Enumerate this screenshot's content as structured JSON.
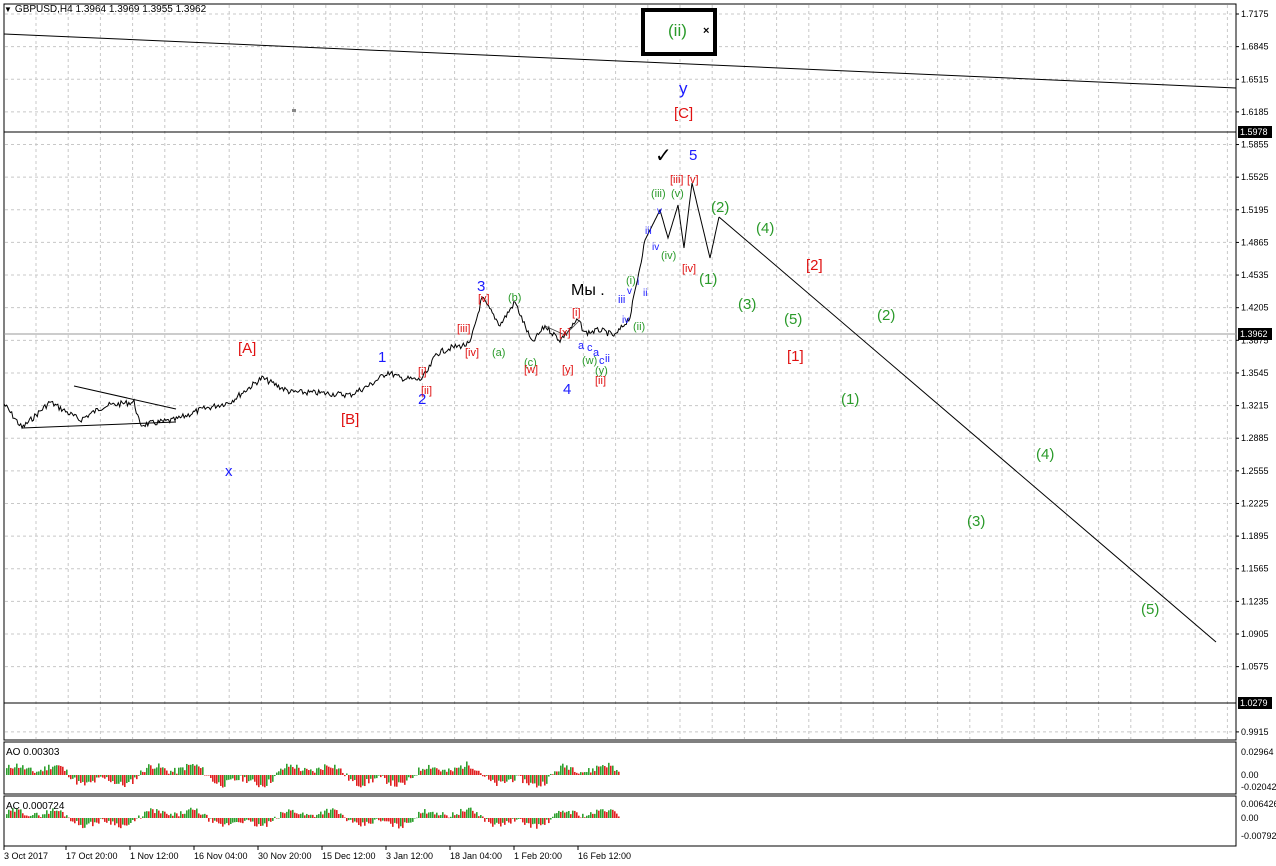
{
  "window": {
    "symbol": "GBPUSD,H4",
    "ohlc": "1.3964 1.3969 1.3955 1.3962"
  },
  "price_axis": {
    "labels": [
      "1.7175",
      "1.6845",
      "1.6515",
      "1.6185",
      "1.5855",
      "1.5525",
      "1.5195",
      "1.4865",
      "1.4535",
      "1.4205",
      "1.3875",
      "1.3545",
      "1.3215",
      "1.2885",
      "1.2555",
      "1.2225",
      "1.1895",
      "1.1565",
      "1.1235",
      "1.0905",
      "1.0575",
      "0.9915"
    ],
    "line_top_label": "1.5978",
    "current_label": "1.3962",
    "line_bottom_label": "1.0279"
  },
  "time_axis": {
    "labels": [
      "3 Oct 2017",
      "17 Oct 20:00",
      "1 Nov 12:00",
      "16 Nov 04:00",
      "30 Nov 20:00",
      "15 Dec 12:00",
      "3 Jan 12:00",
      "18 Jan 04:00",
      "1 Feb 20:00",
      "16 Feb 12:00"
    ]
  },
  "indicators": {
    "ao": {
      "title": "AO 0.00303",
      "axis": [
        "0.02964",
        "0.00",
        "-0.02042"
      ]
    },
    "ac": {
      "title": "AC 0.000724",
      "axis": [
        "0.006426",
        "0.00",
        "-0.00792"
      ]
    }
  },
  "annotations": {
    "box_label": "(ii)",
    "box_close": "×",
    "my_label": "Мы .",
    "check": "✓",
    "w": [
      {
        "t": "y",
        "c": "#1a1aff",
        "s": 17
      },
      {
        "t": "[C]",
        "c": "#e01010",
        "s": 15
      },
      {
        "t": "5",
        "c": "#1a1aff",
        "s": 15
      },
      {
        "t": "[A]",
        "c": "#e01010",
        "s": 15
      },
      {
        "t": "1",
        "c": "#1a1aff",
        "s": 15
      },
      {
        "t": "[B]",
        "c": "#e01010",
        "s": 15
      },
      {
        "t": "x",
        "c": "#1a1aff",
        "s": 15
      },
      {
        "t": "2",
        "c": "#1a1aff",
        "s": 15
      },
      {
        "t": "3",
        "c": "#1a1aff",
        "s": 15
      },
      {
        "t": "4",
        "c": "#1a1aff",
        "s": 15
      },
      {
        "t": "[i]",
        "c": "#e01010",
        "s": 11
      },
      {
        "t": "[ii]",
        "c": "#e01010",
        "s": 11
      },
      {
        "t": "[iii]",
        "c": "#e01010",
        "s": 11
      },
      {
        "t": "[iv]",
        "c": "#e01010",
        "s": 11
      },
      {
        "t": "[v]",
        "c": "#e01010",
        "s": 11
      },
      {
        "t": "(a)",
        "c": "#2a9a2a",
        "s": 11
      },
      {
        "t": "(b)",
        "c": "#2a9a2a",
        "s": 11
      },
      {
        "t": "(c)",
        "c": "#2a9a2a",
        "s": 11
      },
      {
        "t": "[w]",
        "c": "#e01010",
        "s": 11
      },
      {
        "t": "[x]",
        "c": "#e01010",
        "s": 11
      },
      {
        "t": "[y]",
        "c": "#e01010",
        "s": 11
      },
      {
        "t": "[i]",
        "c": "#e01010",
        "s": 11
      },
      {
        "t": "a",
        "c": "#1a1aff",
        "s": 11
      },
      {
        "t": "c",
        "c": "#1a1aff",
        "s": 11
      },
      {
        "t": "a",
        "c": "#1a1aff",
        "s": 11
      },
      {
        "t": "(w)",
        "c": "#2a9a2a",
        "s": 11
      },
      {
        "t": "c",
        "c": "#1a1aff",
        "s": 11
      },
      {
        "t": "ii",
        "c": "#1a1aff",
        "s": 11
      },
      {
        "t": "(y)",
        "c": "#2a9a2a",
        "s": 11
      },
      {
        "t": "[ii]",
        "c": "#e01010",
        "s": 11
      },
      {
        "t": "(i)",
        "c": "#2a9a2a",
        "s": 11
      },
      {
        "t": "(ii)",
        "c": "#2a9a2a",
        "s": 11
      },
      {
        "t": "iii",
        "c": "#1a1aff",
        "s": 11
      },
      {
        "t": "iv",
        "c": "#1a1aff",
        "s": 10
      },
      {
        "t": "v",
        "c": "#1a1aff",
        "s": 10
      },
      {
        "t": "i",
        "c": "#1a1aff",
        "s": 10
      },
      {
        "t": "ii",
        "c": "#1a1aff",
        "s": 10
      },
      {
        "t": "iii",
        "c": "#1a1aff",
        "s": 10
      },
      {
        "t": "iv",
        "c": "#1a1aff",
        "s": 10
      },
      {
        "t": "v",
        "c": "#1a1aff",
        "s": 10
      },
      {
        "t": "(iii)",
        "c": "#2a9a2a",
        "s": 11
      },
      {
        "t": "(iv)",
        "c": "#2a9a2a",
        "s": 11
      },
      {
        "t": "(v)",
        "c": "#2a9a2a",
        "s": 11
      },
      {
        "t": "[iii]",
        "c": "#e01010",
        "s": 11
      },
      {
        "t": "[v]",
        "c": "#e01010",
        "s": 11
      },
      {
        "t": "[iv]",
        "c": "#e01010",
        "s": 11
      },
      {
        "t": "(1)",
        "c": "#2a9a2a",
        "s": 15
      },
      {
        "t": "(2)",
        "c": "#2a9a2a",
        "s": 15
      },
      {
        "t": "(3)",
        "c": "#2a9a2a",
        "s": 15
      },
      {
        "t": "(4)",
        "c": "#2a9a2a",
        "s": 15
      },
      {
        "t": "(5)",
        "c": "#2a9a2a",
        "s": 15
      },
      {
        "t": "[2]",
        "c": "#e01010",
        "s": 15
      },
      {
        "t": "[1]",
        "c": "#e01010",
        "s": 15
      },
      {
        "t": "(2)",
        "c": "#2a9a2a",
        "s": 15
      },
      {
        "t": "(1)",
        "c": "#2a9a2a",
        "s": 15
      },
      {
        "t": "(4)",
        "c": "#2a9a2a",
        "s": 15
      },
      {
        "t": "(3)",
        "c": "#2a9a2a",
        "s": 15
      },
      {
        "t": "(5)",
        "c": "#2a9a2a",
        "s": 15
      }
    ]
  },
  "colors": {
    "grid": "#c8c8c8",
    "bull": "#2ea02e",
    "bear": "#e02020",
    "price_line": "#000000"
  }
}
